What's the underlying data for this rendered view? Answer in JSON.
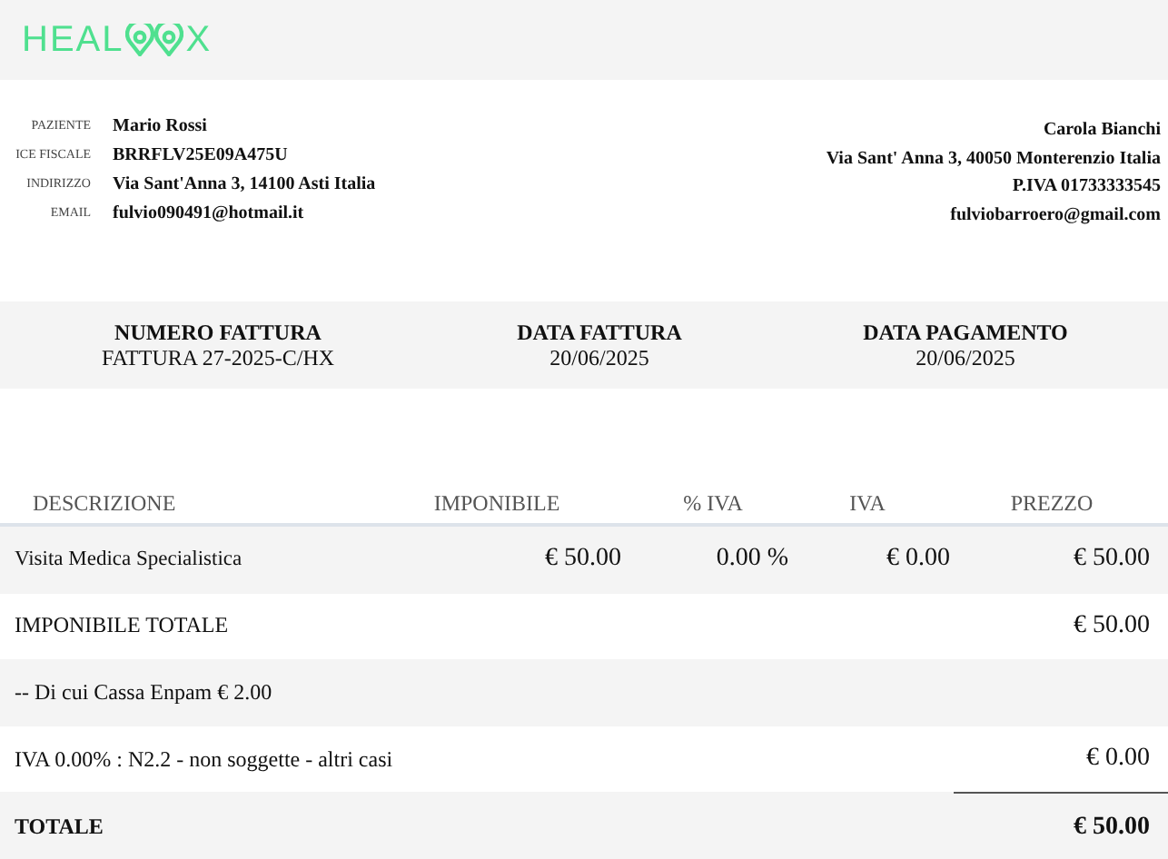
{
  "logo": {
    "before": "HEAL",
    "after": "X"
  },
  "patient": [
    {
      "label": "PAZIENTE",
      "value": "Mario Rossi"
    },
    {
      "label": "ICE FISCALE",
      "value": "BRRFLV25E09A475U"
    },
    {
      "label": "INDIRIZZO",
      "value": "Via Sant'Anna 3, 14100 Asti Italia"
    },
    {
      "label": "EMAIL",
      "value": "fulvio090491@hotmail.it"
    }
  ],
  "doctor": [
    "Carola Bianchi",
    "Via Sant' Anna 3, 40050 Monterenzio Italia",
    "P.IVA 01733333545",
    "fulviobarroero@gmail.com"
  ],
  "invoice_info": [
    {
      "label": "NUMERO FATTURA",
      "value": "FATTURA 27-2025-C/HX"
    },
    {
      "label": "DATA FATTURA",
      "value": "20/06/2025"
    },
    {
      "label": "DATA PAGAMENTO",
      "value": "20/06/2025"
    }
  ],
  "table": {
    "columns": [
      "DESCRIZIONE",
      "IMPONIBILE",
      "% IVA",
      "IVA",
      "PREZZO"
    ],
    "rows": [
      {
        "kind": "item",
        "cells": [
          "Visita Medica Specialistica",
          "€ 50.00",
          "0.00 %",
          "€ 0.00",
          "€ 50.00"
        ]
      },
      {
        "kind": "summary",
        "label": "IMPONIBILE TOTALE",
        "amount": "€ 50.00"
      },
      {
        "kind": "note",
        "label": "-- Di cui Cassa Enpam € 2.00"
      },
      {
        "kind": "summary",
        "label": "IVA 0.00% : N2.2 - non soggette - altri casi",
        "amount": "€ 0.00"
      },
      {
        "kind": "total",
        "label": "TOTALE",
        "amount": "€ 50.00"
      }
    ]
  }
}
